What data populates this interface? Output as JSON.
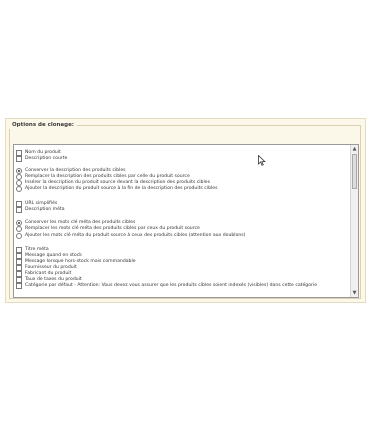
{
  "fieldset": {
    "legend": "Options de clonage:"
  },
  "options": [
    {
      "type": "checkbox",
      "label": "Nom du produit"
    },
    {
      "type": "checkbox",
      "label": "Description courte"
    },
    {
      "type": "radio",
      "checked": true,
      "label": "Conserver la description des produits cibles"
    },
    {
      "type": "radio",
      "checked": false,
      "label": "Remplacer la description des produits cibles par celle du produit source"
    },
    {
      "type": "radio",
      "checked": false,
      "label": "Insérer la description du produit source devant la description des produits cibles"
    },
    {
      "type": "radio",
      "checked": false,
      "label": "Ajouter la description du produit source à la fin de la description des produits cibles"
    },
    {
      "type": "checkbox",
      "label": "URL simplifiés"
    },
    {
      "type": "checkbox",
      "label": "Description méta"
    },
    {
      "type": "radio",
      "checked": true,
      "label": "Conserver les mots clé méta des produits cibles"
    },
    {
      "type": "radio",
      "checked": false,
      "label": "Remplacer les mots clé méta des produits cibles par ceux du produit source"
    },
    {
      "type": "radio",
      "checked": false,
      "label": "Ajouter les mots clé méta du produit source à ceux des produits cibles (attention aux doublons)"
    },
    {
      "type": "checkbox",
      "label": "Titre méta"
    },
    {
      "type": "checkbox",
      "label": "Message quand en stock"
    },
    {
      "type": "checkbox",
      "label": "Message lorsque hors-stock mais commandable"
    },
    {
      "type": "checkbox",
      "label": "Fournisseur du produit"
    },
    {
      "type": "checkbox",
      "label": "Fabricant du produit"
    },
    {
      "type": "checkbox",
      "label": "Taux de taxes du produit"
    },
    {
      "type": "checkbox",
      "label": "Catégorie par défaut - Attention: Vous devez vous assurer que les produits cibles soient indexés (visibles) dans cette catégorie"
    }
  ],
  "scrollbar": {
    "up_icon": "arrow-up-icon",
    "down_icon": "arrow-down-icon",
    "position": 0.0
  }
}
